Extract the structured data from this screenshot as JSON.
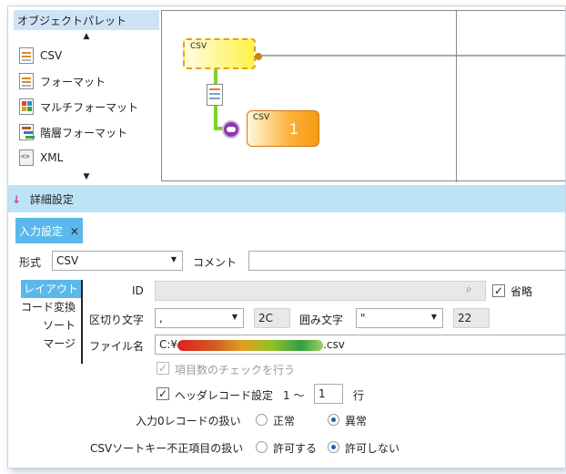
{
  "palette": {
    "header": "オブジェクトパレット",
    "up_arrow": "▲",
    "down_arrow": "▼",
    "items": [
      {
        "label": "CSV",
        "icon": "csv-file-icon"
      },
      {
        "label": "フォーマット",
        "icon": "format-file-icon"
      },
      {
        "label": "マルチフォーマット",
        "icon": "multi-format-icon"
      },
      {
        "label": "階層フォーマット",
        "icon": "hierarchy-format-icon"
      },
      {
        "label": "XML",
        "icon": "xml-icon"
      }
    ]
  },
  "canvas": {
    "node1_label": "CSV",
    "node2_label": "CSV",
    "node2_count": "1"
  },
  "detail": {
    "title": "詳細設定",
    "arrow": "↓"
  },
  "tab": {
    "label": "入力設定",
    "close": "✕"
  },
  "format_row": {
    "format_label": "形式",
    "format_value": "CSV",
    "comment_label": "コメント",
    "comment_value": ""
  },
  "sidenav": {
    "items": [
      "レイアウト",
      "コード変換",
      "ソート",
      "マージ"
    ]
  },
  "layout": {
    "id_label": "ID",
    "id_value": "",
    "omit_label": "省略",
    "omit_checked": true,
    "delimiter_label": "区切り文字",
    "delimiter_value": ",",
    "delimiter_hex": "2C",
    "quote_label": "囲み文字",
    "quote_value": "\"",
    "quote_hex": "22",
    "file_label": "ファイル名",
    "file_prefix": "C:¥",
    "file_suffix": ".csv",
    "check_items_label": "項目数のチェックを行う",
    "header_record_label": "ヘッダレコード設定",
    "header_from": "1 ～",
    "header_to": "1",
    "header_unit": "行",
    "zero_record_label": "入力0レコードの扱い",
    "zero_opt1": "正常",
    "zero_opt2": "異常",
    "sortkey_label": "CSVソートキー不正項目の扱い",
    "sortkey_opt1": "許可する",
    "sortkey_opt2": "許可しない"
  },
  "colors": {
    "accent": "#5bb8ea",
    "detail_bar": "#bfe3f6",
    "palette_header": "#cfe3f7",
    "node_yellow": "#fff24a",
    "node_orange": "#f39a10",
    "connector": "#7ed22a"
  }
}
